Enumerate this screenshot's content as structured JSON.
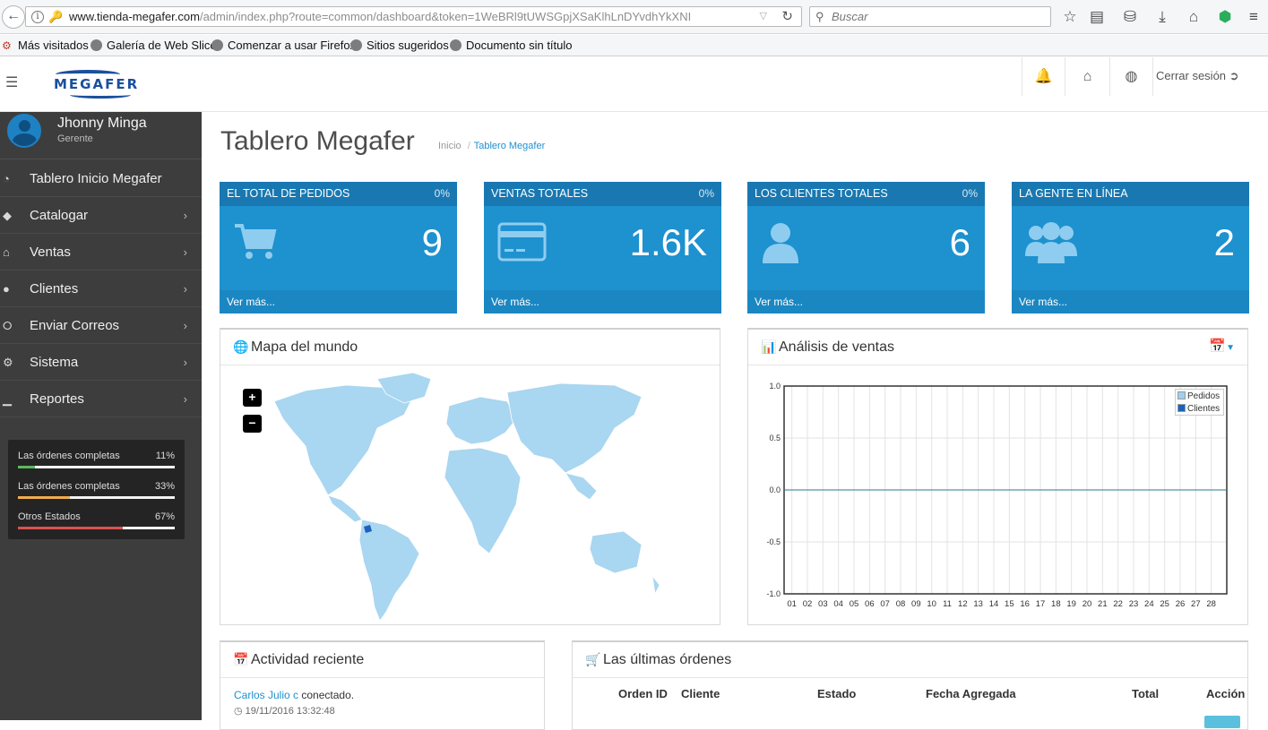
{
  "browser": {
    "url_host": "www.tienda-megafer.com",
    "url_path": "/admin/index.php?route=common/dashboard&token=1WeBRl9tUWSGpjXSaKlhLnDYvdhYkXNI",
    "search_placeholder": "Buscar"
  },
  "bookmarks": [
    "Más visitados",
    "Galería de Web Slice",
    "Comenzar a usar Firefox",
    "Sitios sugeridos",
    "Documento sin título"
  ],
  "header": {
    "logo_text": "MEGAFER",
    "logout_label": "Cerrar sesión"
  },
  "sidebar": {
    "profile_name": "Jhonny Minga",
    "profile_role": "Gerente",
    "items": [
      {
        "label": "Tablero Inicio Megafer",
        "icon": "dashboard-icon",
        "chevron": false
      },
      {
        "label": "Catalogar",
        "icon": "tag-icon",
        "chevron": true
      },
      {
        "label": "Ventas",
        "icon": "cart-icon",
        "chevron": true
      },
      {
        "label": "Clientes",
        "icon": "user-icon",
        "chevron": true
      },
      {
        "label": "Enviar Correos",
        "icon": "share-icon",
        "chevron": true
      },
      {
        "label": "Sistema",
        "icon": "cog-icon",
        "chevron": true
      },
      {
        "label": "Reportes",
        "icon": "bar-chart-icon",
        "chevron": true
      }
    ],
    "status": [
      {
        "label": "Las órdenes completas",
        "pct": "11%",
        "fraction": 0.11,
        "color": "#5cb85c"
      },
      {
        "label": "Las órdenes completas",
        "pct": "33%",
        "fraction": 0.33,
        "color": "#f0ad4e"
      },
      {
        "label": "Otros Estados",
        "pct": "67%",
        "fraction": 0.67,
        "color": "#d9534f"
      }
    ]
  },
  "page": {
    "title": "Tablero Megafer",
    "breadcrumb_home": "Inicio",
    "breadcrumb_active": "Tablero Megafer"
  },
  "tiles": [
    {
      "title": "EL TOTAL DE PEDIDOS",
      "pct": "0%",
      "value": "9",
      "more": "Ver más...",
      "icon": "shopping-cart-icon"
    },
    {
      "title": "VENTAS TOTALES",
      "pct": "0%",
      "value": "1.6K",
      "more": "Ver más...",
      "icon": "credit-card-icon"
    },
    {
      "title": "LOS CLIENTES TOTALES",
      "pct": "0%",
      "value": "6",
      "more": "Ver más...",
      "icon": "user-icon"
    },
    {
      "title": "LA GENTE EN LÍNEA",
      "pct": "",
      "value": "2",
      "more": "Ver más...",
      "icon": "users-icon"
    }
  ],
  "map_panel": {
    "title": "Mapa del mundo",
    "zoom_in": "+",
    "zoom_out": "−"
  },
  "sales_panel": {
    "title": "Análisis de ventas"
  },
  "chart_data": {
    "type": "line",
    "x": [
      "01",
      "02",
      "03",
      "04",
      "05",
      "06",
      "07",
      "08",
      "09",
      "10",
      "11",
      "12",
      "13",
      "14",
      "15",
      "16",
      "17",
      "18",
      "19",
      "20",
      "21",
      "22",
      "23",
      "24",
      "25",
      "26",
      "27",
      "28"
    ],
    "yticks": [
      "1.0",
      "0.5",
      "0.0",
      "-0.5",
      "-1.0"
    ],
    "ylim": [
      -1.0,
      1.0
    ],
    "grid": true,
    "legend_position": "top-right",
    "series": [
      {
        "name": "Pedidos",
        "color": "#9fd0ec",
        "values": [
          0,
          0,
          0,
          0,
          0,
          0,
          0,
          0,
          0,
          0,
          0,
          0,
          0,
          0,
          0,
          0,
          0,
          0,
          0,
          0,
          0,
          0,
          0,
          0,
          0,
          0,
          0,
          0
        ]
      },
      {
        "name": "Clientes",
        "color": "#1565c0",
        "values": [
          0,
          0,
          0,
          0,
          0,
          0,
          0,
          0,
          0,
          0,
          0,
          0,
          0,
          0,
          0,
          0,
          0,
          0,
          0,
          0,
          0,
          0,
          0,
          0,
          0,
          0,
          0,
          0
        ]
      }
    ]
  },
  "activity_panel": {
    "title": "Actividad reciente",
    "items": [
      {
        "user": "Carlos Julio c",
        "text": " conectado.",
        "time": "19/11/2016 13:32:48"
      }
    ]
  },
  "orders_panel": {
    "title": "Las últimas órdenes",
    "columns": [
      "Orden ID",
      "Cliente",
      "Estado",
      "Fecha Agregada",
      "Total",
      "Acción"
    ]
  }
}
